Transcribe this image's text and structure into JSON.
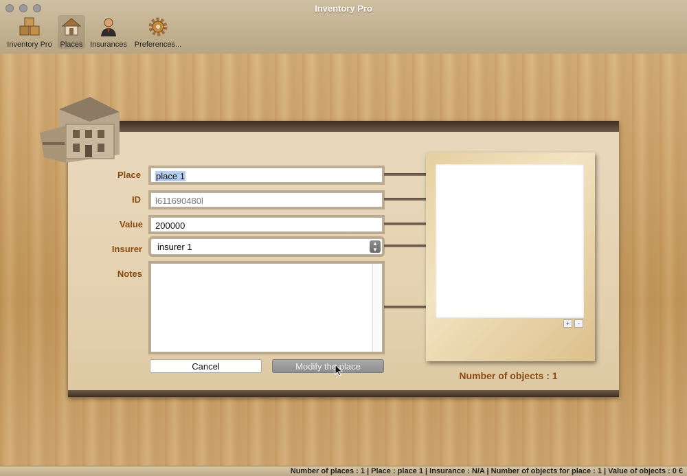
{
  "window": {
    "title": "Inventory Pro"
  },
  "toolbar": {
    "items": [
      {
        "label": "Inventory Pro",
        "icon": "boxes-icon"
      },
      {
        "label": "Places",
        "icon": "house-icon"
      },
      {
        "label": "Insurances",
        "icon": "agent-icon"
      },
      {
        "label": "Preferences...",
        "icon": "gear-icon"
      }
    ]
  },
  "form": {
    "place_label": "Place",
    "place_value": "place 1",
    "id_label": "ID",
    "id_value": "l611690480l",
    "value_label": "Value",
    "value_value": "200000",
    "insurer_label": "Insurer",
    "insurer_value": "insurer 1",
    "notes_label": "Notes",
    "notes_value": ""
  },
  "buttons": {
    "cancel": "Cancel",
    "modify": "Modify the place"
  },
  "photo": {
    "add": "+",
    "remove": "-"
  },
  "objects_count": "Number of objects : 1",
  "status": "Number of places : 1 | Place : place 1 | Insurance : N/A | Number of objects for place : 1 | Value of objects : 0 €",
  "colors": {
    "label": "#8a4a12",
    "panel_bar": "#3e2e22",
    "wood": "#c79b60"
  }
}
